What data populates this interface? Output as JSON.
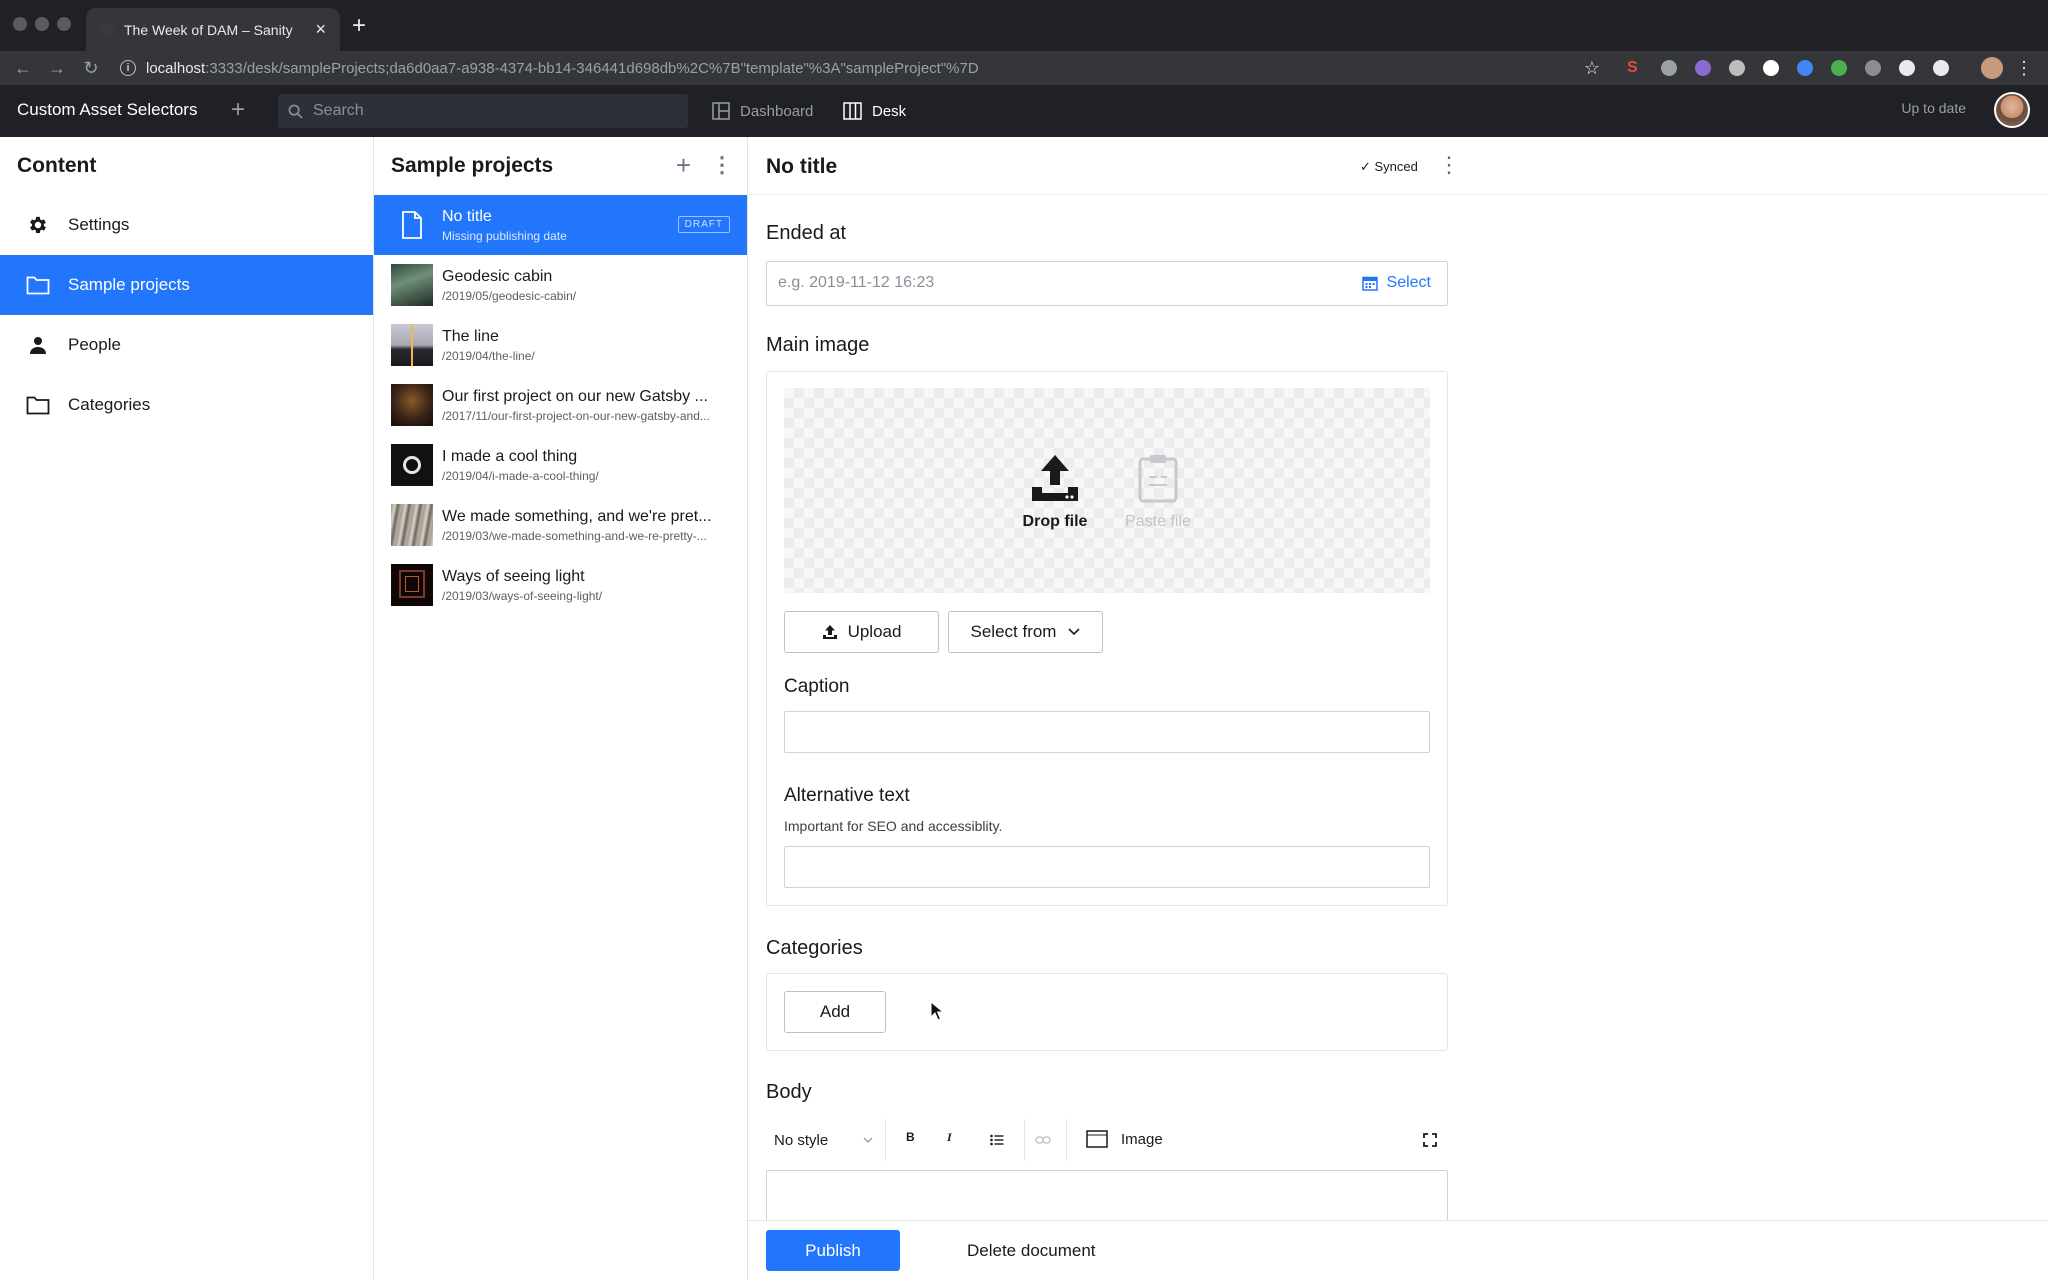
{
  "browser": {
    "tab_title": "The Week of DAM – Sanity",
    "url_host": "localhost",
    "url_path": ":3333/desk/sampleProjects;da6d0aa7-a938-4374-bb14-346441d698db%2C%7B\"template\"%3A\"sampleProject\"%7D"
  },
  "appbar": {
    "brand": "Custom Asset Selectors",
    "search_placeholder": "Search",
    "tools": [
      {
        "label": "Dashboard",
        "icon": "dashboard-icon"
      },
      {
        "label": "Desk",
        "icon": "desk-icon"
      }
    ],
    "status": "Up to date"
  },
  "content_pane": {
    "title": "Content",
    "items": [
      {
        "label": "Settings",
        "icon": "gear-icon"
      },
      {
        "label": "Sample projects",
        "icon": "folder-icon"
      },
      {
        "label": "People",
        "icon": "person-icon"
      },
      {
        "label": "Categories",
        "icon": "folder-icon"
      }
    ]
  },
  "list_pane": {
    "title": "Sample projects",
    "documents": [
      {
        "title": "No title",
        "subtitle": "Missing publishing date",
        "badge": "DRAFT"
      },
      {
        "title": "Geodesic cabin",
        "subtitle": "/2019/05/geodesic-cabin/"
      },
      {
        "title": "The line",
        "subtitle": "/2019/04/the-line/"
      },
      {
        "title": "Our first project on our new Gatsby ...",
        "subtitle": "/2017/11/our-first-project-on-our-new-gatsby-and..."
      },
      {
        "title": "I made a cool thing",
        "subtitle": "/2019/04/i-made-a-cool-thing/"
      },
      {
        "title": "We made something, and we're pret...",
        "subtitle": "/2019/03/we-made-something-and-we-re-pretty-..."
      },
      {
        "title": "Ways of seeing light",
        "subtitle": "/2019/03/ways-of-seeing-light/"
      }
    ]
  },
  "editor": {
    "title": "No title",
    "sync_status": "Synced",
    "ended_at": {
      "label": "Ended at",
      "placeholder": "e.g. 2019-11-12 16:23",
      "select_label": "Select"
    },
    "main_image": {
      "label": "Main image",
      "drop_label": "Drop file",
      "paste_label": "Paste file",
      "upload_label": "Upload",
      "select_from_label": "Select from",
      "caption_label": "Caption",
      "alt_label": "Alternative text",
      "alt_description": "Important for SEO and accessiblity."
    },
    "categories": {
      "label": "Categories",
      "add_label": "Add"
    },
    "body": {
      "label": "Body",
      "style_select": "No style",
      "bold": "B",
      "italic": "I",
      "image_label": "Image"
    },
    "publish_label": "Publish",
    "delete_label": "Delete document"
  }
}
